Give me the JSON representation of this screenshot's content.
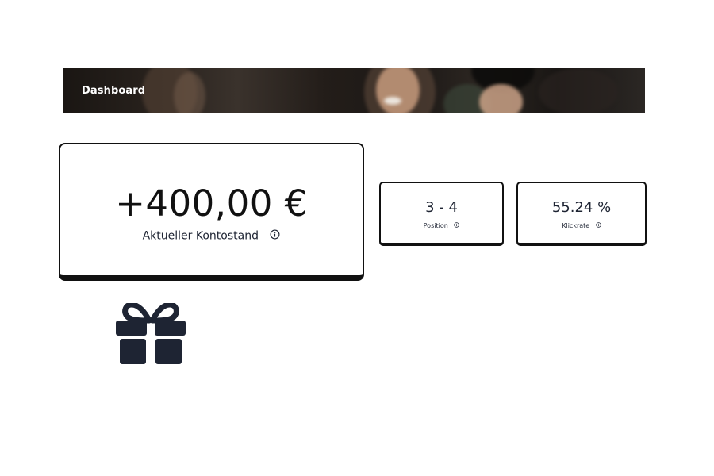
{
  "banner": {
    "title": "Dashboard"
  },
  "balance": {
    "amount": "+400,00 €",
    "label": "Aktueller Kontostand",
    "icon": "info-icon"
  },
  "stats": {
    "position": {
      "value": "3 - 4",
      "label": "Position",
      "icon": "info-icon"
    },
    "clickrate": {
      "value": "55.24 %",
      "label": "Klickrate",
      "icon": "info-icon"
    }
  },
  "gift": {
    "icon": "gift-icon"
  },
  "colors": {
    "text": "#1e2433",
    "border": "#111111",
    "icon": "#1e2433"
  }
}
